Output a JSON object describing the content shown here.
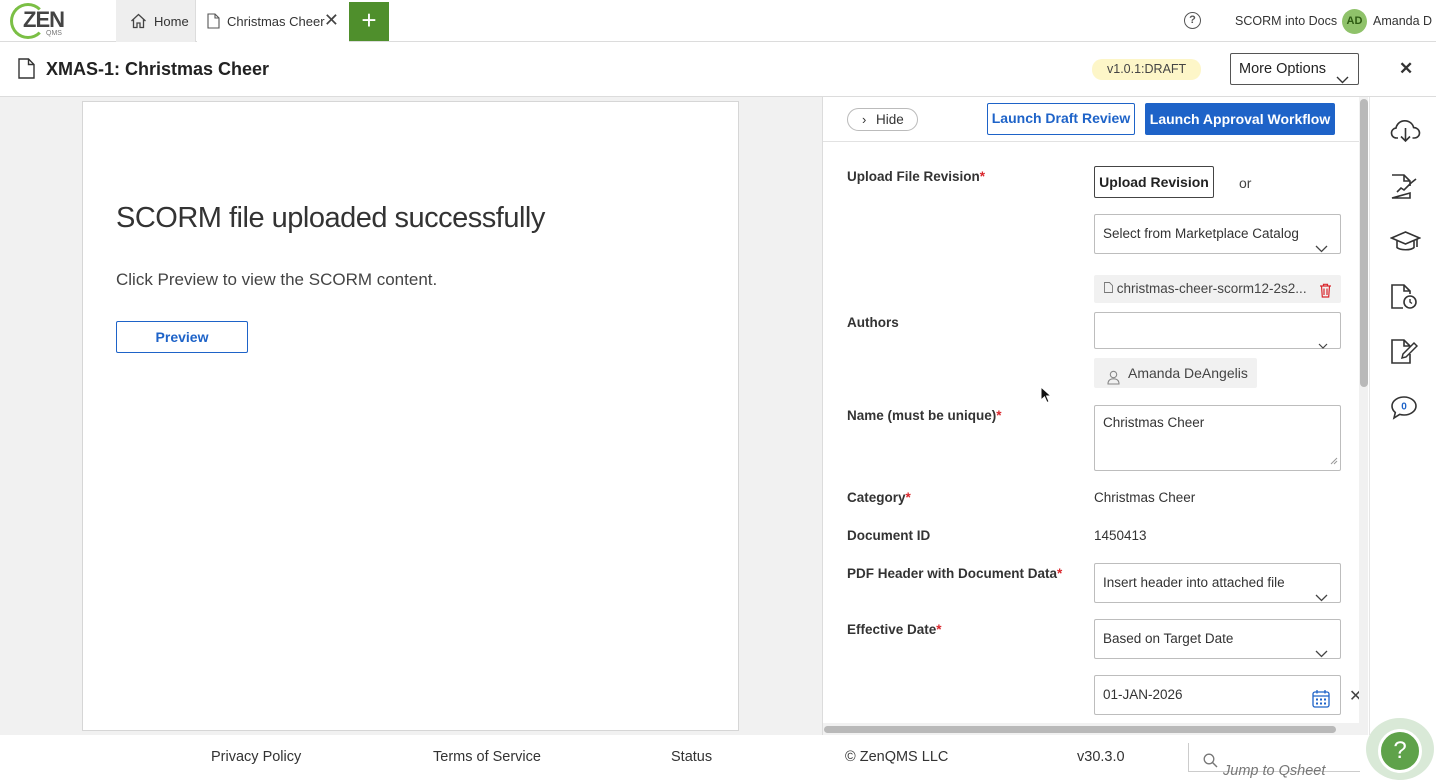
{
  "app": {
    "logo_text": "ZEN",
    "logo_sub": "QMS"
  },
  "tabs": {
    "home_label": "Home",
    "doc_label": "Christmas Cheer",
    "add_label": "+"
  },
  "header": {
    "org": "SCORM into Docs",
    "avatar_initials": "AD",
    "user": "Amanda D"
  },
  "document": {
    "title": "XMAS-1: Christmas Cheer",
    "version": "v1.0.1:DRAFT",
    "more_options": "More Options"
  },
  "viewer": {
    "heading": "SCORM file uploaded successfully",
    "message": "Click Preview to view the SCORM content.",
    "preview_label": "Preview"
  },
  "panel": {
    "hide_label": "Hide",
    "launch_draft": "Launch Draft Review",
    "launch_approval": "Launch Approval Workflow",
    "upload_label": "Upload File Revision",
    "upload_button": "Upload Revision",
    "or_text": "or",
    "marketplace": "Select from Marketplace Catalog",
    "file_name": "christmas-cheer-scorm12-2s2...",
    "authors_label": "Authors",
    "authors_value": "",
    "author_chip": "Amanda DeAngelis",
    "name_label": "Name (must be unique)",
    "name_value": "Christmas Cheer",
    "category_label": "Category",
    "category_value": "Christmas Cheer",
    "docid_label": "Document ID",
    "docid_value": "1450413",
    "pdf_label": "PDF Header with Document Data",
    "pdf_value": "Insert header into attached file",
    "effective_label": "Effective Date",
    "effective_value": "Based on Target Date",
    "date_value": "01-JAN-2026"
  },
  "rail": {
    "comment_count": "0"
  },
  "footer": {
    "privacy": "Privacy Policy",
    "terms": "Terms of Service",
    "status": "Status",
    "copyright": "© ZenQMS LLC",
    "version": "v30.3.0",
    "jump_placeholder": "Jump to Qsheet",
    "help": "?"
  },
  "colors": {
    "primary": "#1e63c8",
    "brand_green": "#4f8f2c",
    "required": "#d9262c",
    "draft_badge": "#fdf6c8"
  }
}
